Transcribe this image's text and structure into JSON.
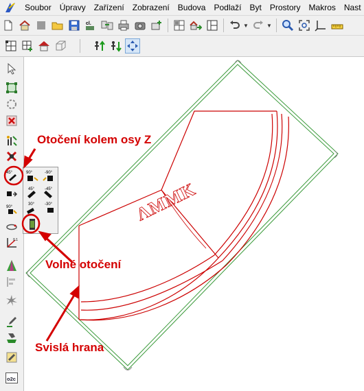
{
  "menu": {
    "items": [
      "Soubor",
      "Úpravy",
      "Zařízení",
      "Zobrazení",
      "Budova",
      "Podlaží",
      "Byt",
      "Prostory",
      "Makros",
      "Nast"
    ]
  },
  "toolbar_main": {
    "icons": [
      "new-file-icon",
      "open-house-icon",
      "blank-icon",
      "open-folder-icon",
      "save-icon",
      "cl-icon",
      "compare-icon",
      "print-icon",
      "camera-icon",
      "add-layer-icon",
      "grid-view-icon",
      "house-arrow-icon",
      "plan-icon",
      "undo-icon",
      "redo-icon",
      "zoom-icon",
      "zoom-window-icon",
      "axes-icon",
      "ruler-icon"
    ]
  },
  "toolbar_secondary": {
    "icons": [
      "select-region-icon",
      "select-region-plus-icon",
      "house-icon",
      "box-3d-icon",
      "move-up-icon",
      "move-down-icon",
      "fit-icon"
    ]
  },
  "left_toolbar": {
    "icons": [
      "cursor-icon",
      "select-element-icon",
      "select-group-icon",
      "delete-selection-icon",
      "transform-icon",
      "delete-x-icon",
      "rotate-45-icon",
      "shift-icon",
      "rotate-90-icon",
      "orbit-icon",
      "axis-icon",
      "color-ramp-icon",
      "align-icon",
      "spiky-icon",
      "eyedropper-icon",
      "paint-icon",
      "brush-icon"
    ],
    "o2c_label": "o2c"
  },
  "rotation_flyout": {
    "labels": [
      "45°",
      "90°",
      "-90°",
      "-45°",
      "45°",
      "30°",
      "-30°"
    ]
  },
  "drawing": {
    "embossed_text": "ΛMMK",
    "colors": {
      "outline": "#cc0000",
      "bounding_box": "#3a9a3a",
      "annotation": "#d40000"
    }
  },
  "annotations": {
    "rotate_z": "Otočení kolem osy Z",
    "free_rotation": "Volné otočení",
    "vertical_edge": "Svislá hrana"
  }
}
